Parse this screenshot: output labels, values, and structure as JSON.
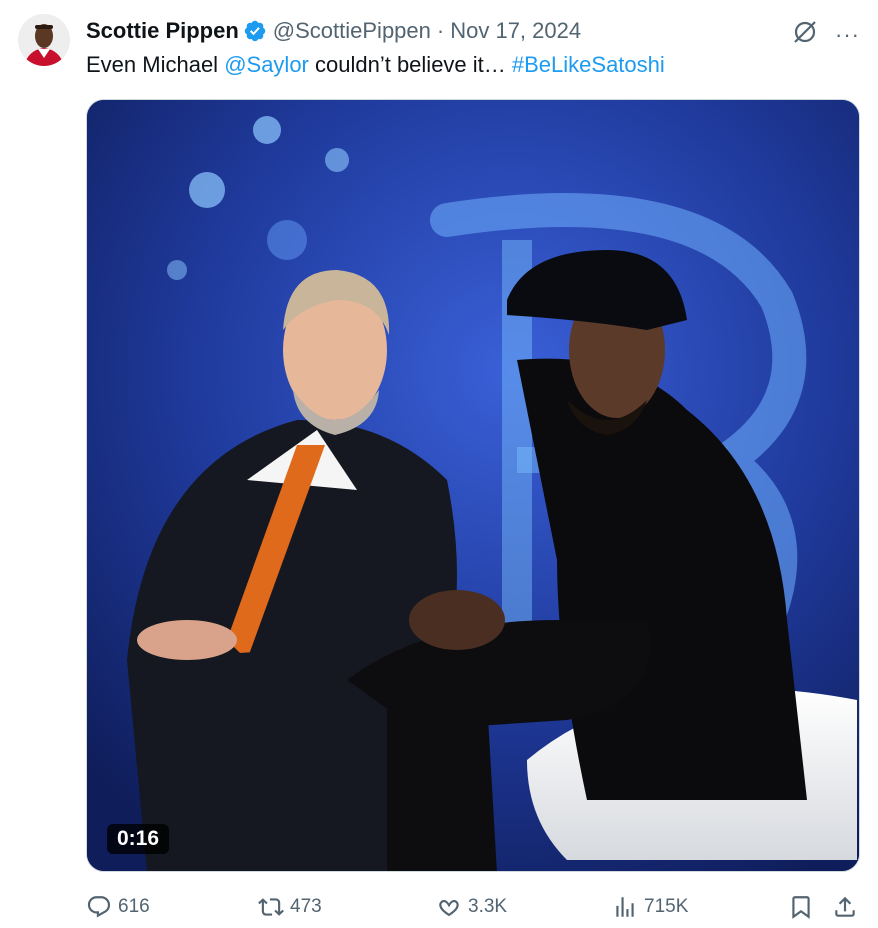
{
  "author": {
    "display_name": "Scottie Pippen",
    "handle": "@ScottiePippen",
    "separator": "·",
    "date": "Nov 17, 2024",
    "verified_color": "#1d9bf0"
  },
  "tweet": {
    "text_prefix": "Even Michael ",
    "mention": "@Saylor",
    "text_middle": " couldn’t believe it… ",
    "hashtag": "#BeLikeSatoshi",
    "link_color": "#1d9bf0"
  },
  "media": {
    "duration": "0:16"
  },
  "top_actions": {
    "more_label": "···"
  },
  "stats": {
    "replies": "616",
    "reposts": "473",
    "likes": "3.3K",
    "views": "715K"
  }
}
